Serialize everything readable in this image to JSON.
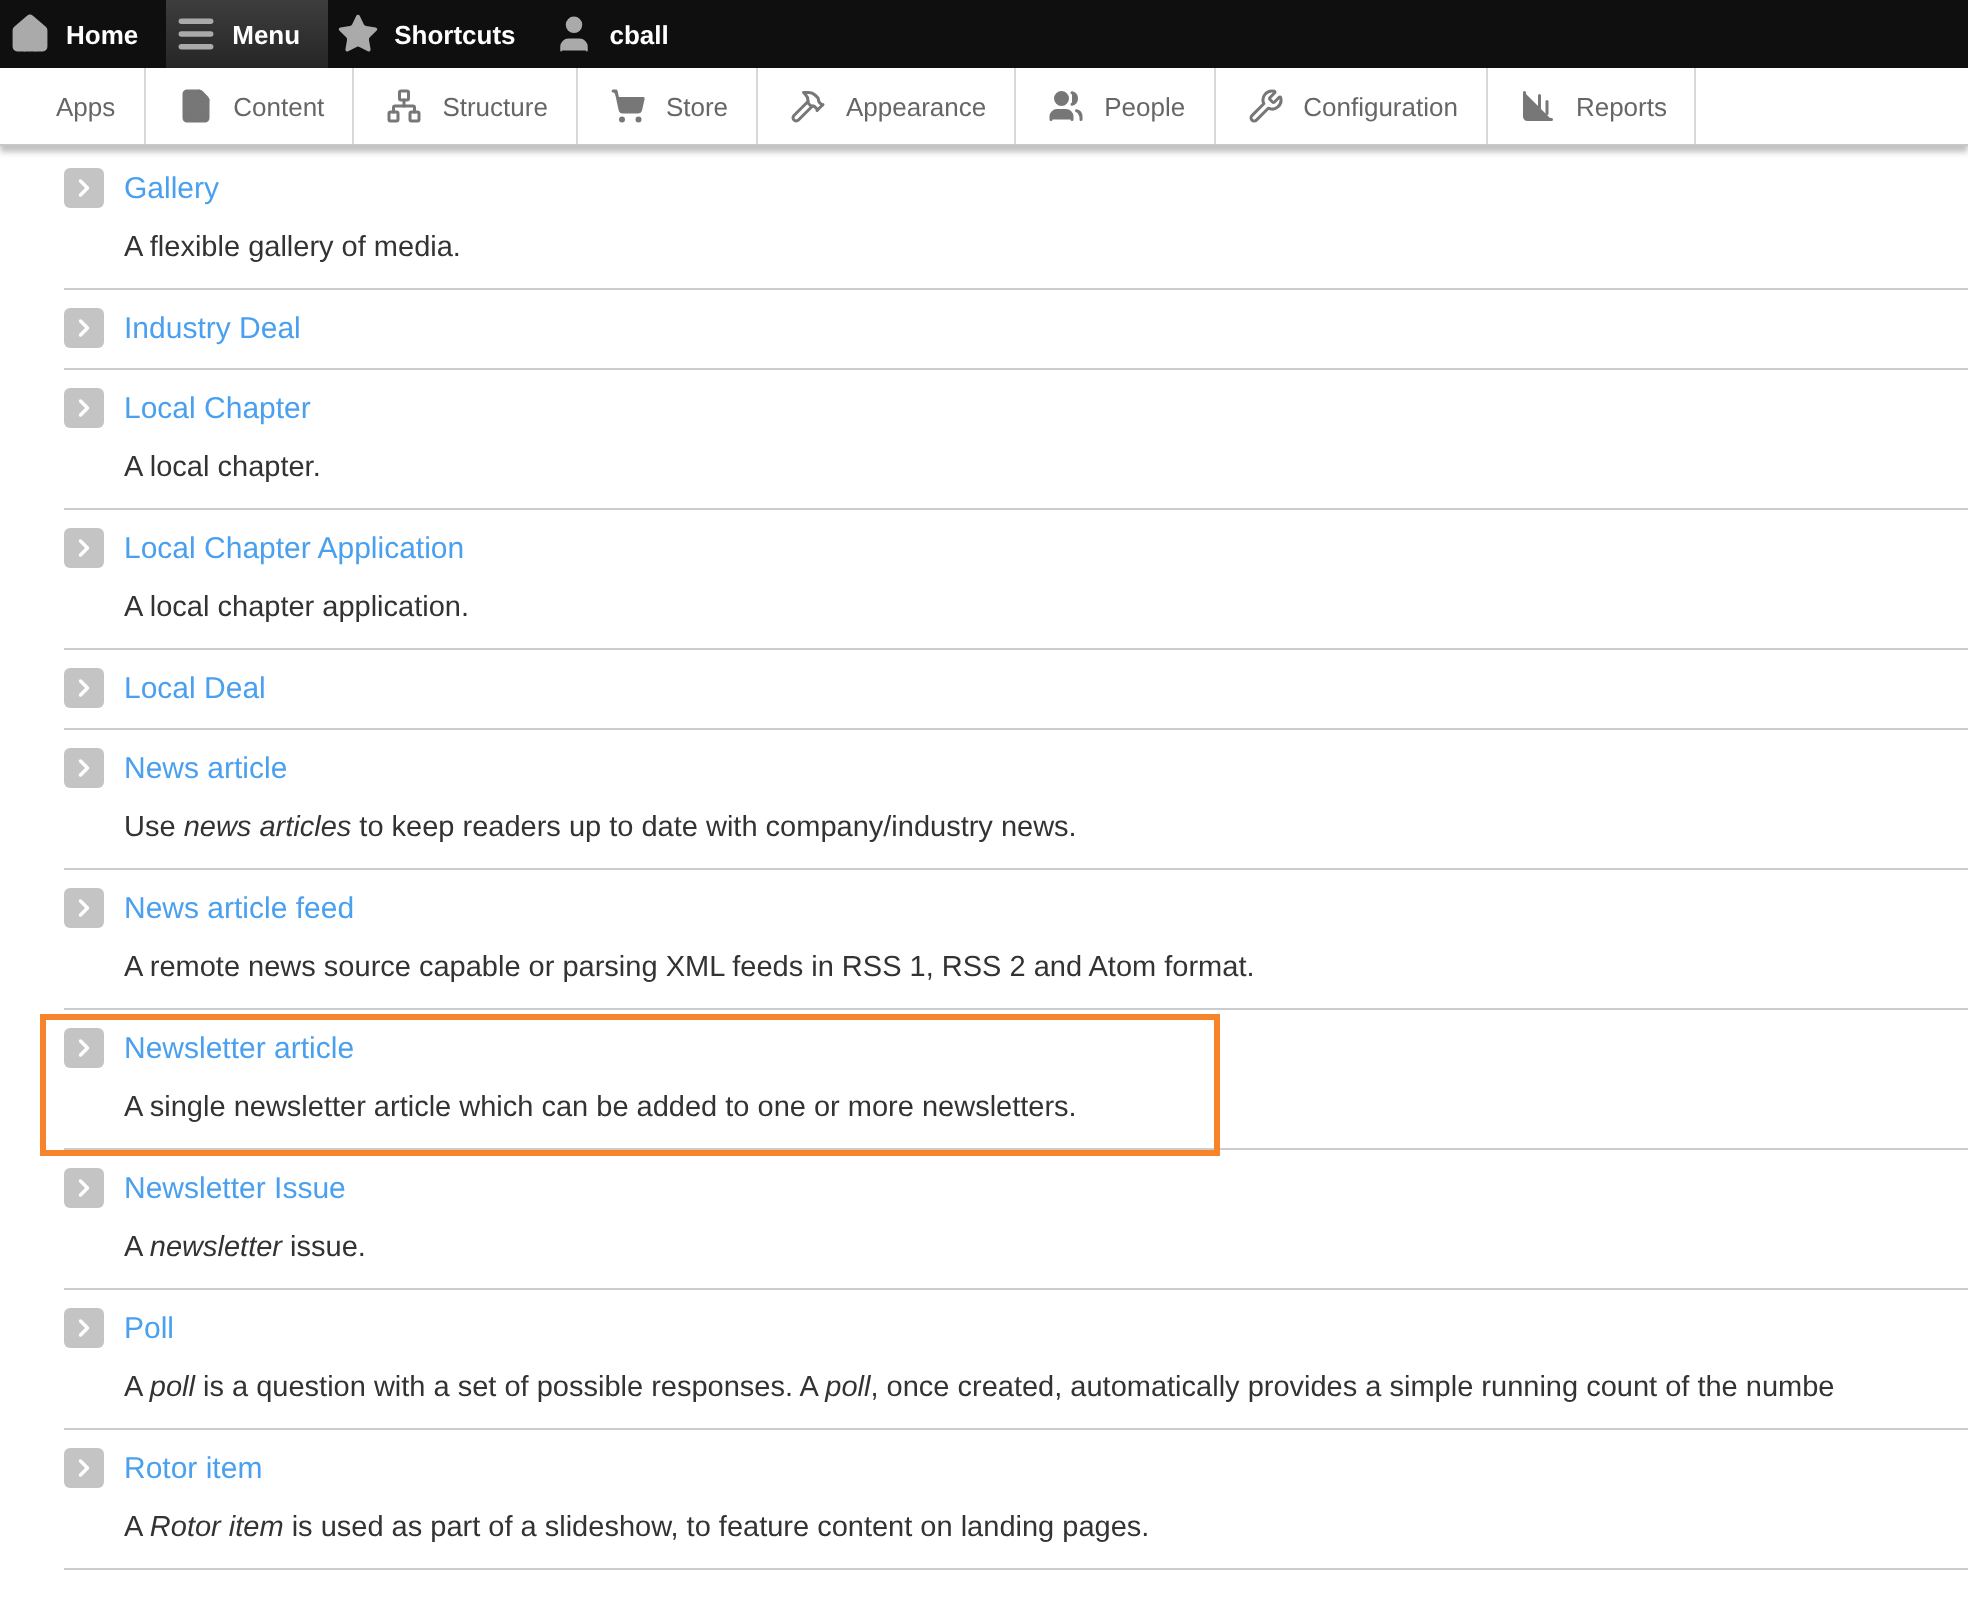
{
  "toolbar": [
    {
      "label": "Home",
      "selected": false
    },
    {
      "label": "Menu",
      "selected": true
    },
    {
      "label": "Shortcuts",
      "selected": false
    },
    {
      "label": "cball",
      "selected": false
    }
  ],
  "tray": [
    {
      "label": "Apps"
    },
    {
      "label": "Content"
    },
    {
      "label": "Structure"
    },
    {
      "label": "Store"
    },
    {
      "label": "Appearance"
    },
    {
      "label": "People"
    },
    {
      "label": "Configuration"
    },
    {
      "label": "Reports"
    }
  ],
  "content_types": [
    {
      "title": "Gallery",
      "description": "A flexible gallery of media.",
      "highlighted": false
    },
    {
      "title": "Industry Deal",
      "highlighted": false
    },
    {
      "title": "Local Chapter",
      "description": "A local chapter.",
      "highlighted": false
    },
    {
      "title": "Local Chapter Application",
      "description": "A local chapter application.",
      "highlighted": false
    },
    {
      "title": "Local Deal",
      "highlighted": false
    },
    {
      "title": "News article",
      "description": "Use *news articles* to keep readers up to date with company/industry news.",
      "highlighted": false
    },
    {
      "title": "News article feed",
      "description": "A remote news source capable or parsing XML feeds in RSS 1, RSS 2 and Atom format.",
      "highlighted": false
    },
    {
      "title": "Newsletter article",
      "description": "A single newsletter article which can be added to one or more newsletters.",
      "highlighted": true
    },
    {
      "title": "Newsletter Issue",
      "description": "A *newsletter* issue.",
      "highlighted": false
    },
    {
      "title": "Poll",
      "description": "A *poll* is a question with a set of possible responses. A *poll*, once created, automatically provides a simple running count of the numbe",
      "highlighted": false
    },
    {
      "title": "Rotor item",
      "description": "A *Rotor item* is used as part of a slideshow, to feature content on landing pages.",
      "highlighted": false
    }
  ]
}
